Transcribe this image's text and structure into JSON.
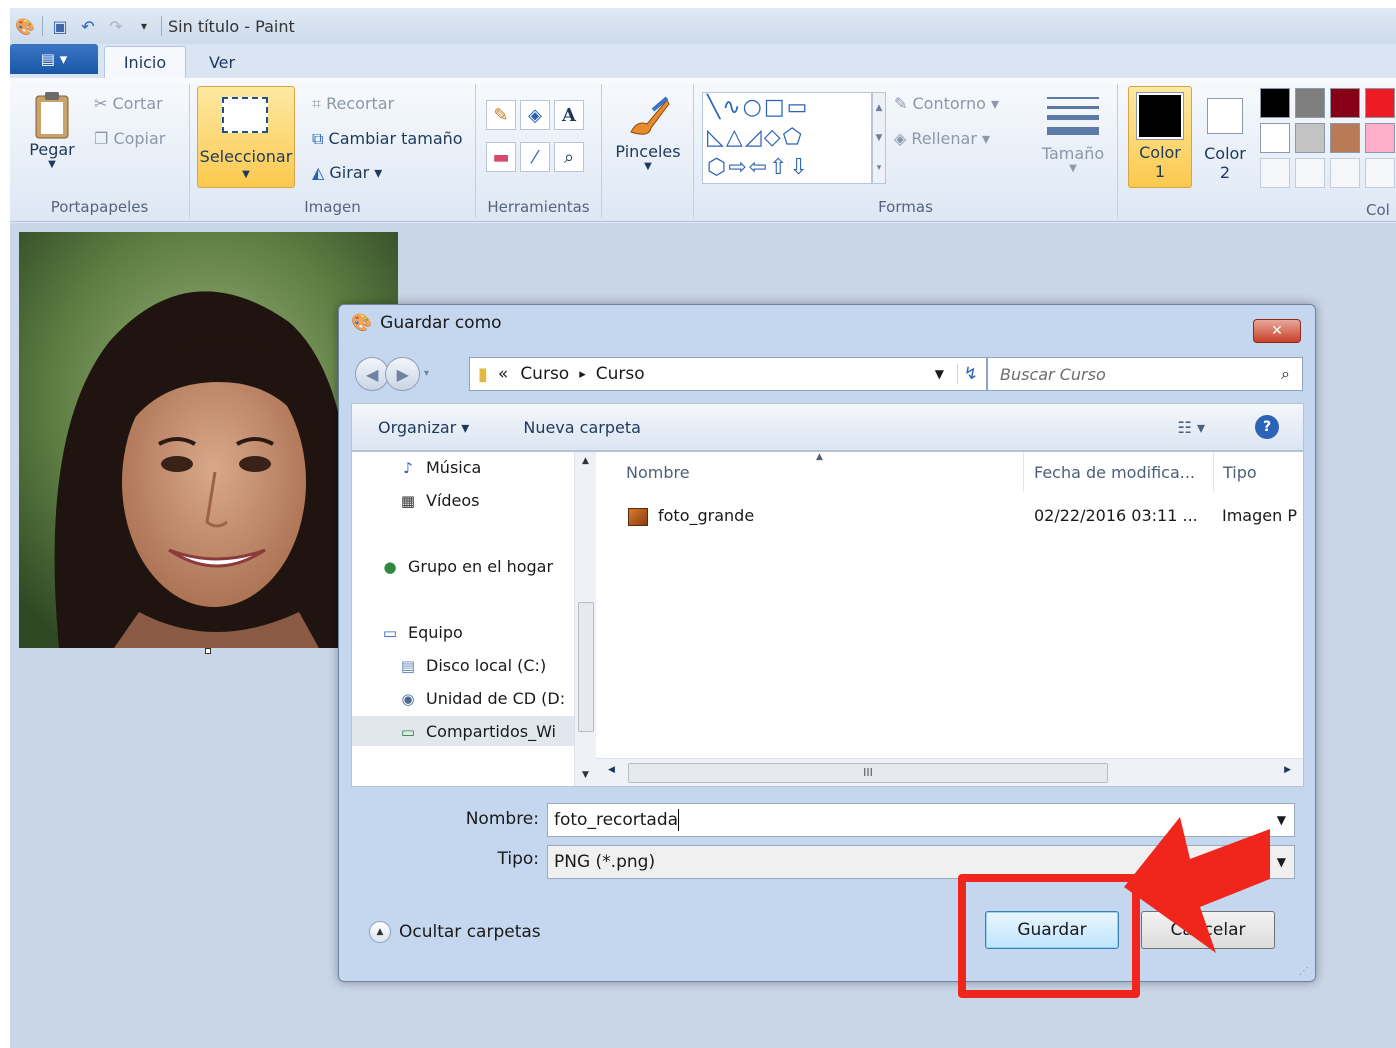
{
  "window": {
    "title": "Sin título - Paint"
  },
  "tabs": {
    "file": "▤ ▾",
    "inicio": "Inicio",
    "ver": "Ver"
  },
  "ribbon": {
    "portapapeles": {
      "label": "Portapapeles",
      "pegar": "Pegar",
      "cortar": "Cortar",
      "copiar": "Copiar"
    },
    "imagen": {
      "label": "Imagen",
      "seleccionar": "Seleccionar",
      "recortar": "Recortar",
      "cambiar": "Cambiar tamaño",
      "girar": "Girar ▾"
    },
    "herramientas": {
      "label": "Herramientas"
    },
    "pinceles": "Pinceles",
    "formas": {
      "label": "Formas",
      "contorno": "Contorno ▾",
      "rellenar": "Rellenar ▾"
    },
    "tamano": "Tamaño",
    "color1": "Color\n1",
    "color2": "Color\n2",
    "colores_label": "Col",
    "palette": [
      "#000000",
      "#7f7f7f",
      "#880015",
      "#ed1c24",
      "#ffffff",
      "#c3c3c3",
      "#b97a57",
      "#ffaec9"
    ]
  },
  "dialog": {
    "title": "Guardar como",
    "close": "✕",
    "breadcrumb": {
      "prefix": "«",
      "part1": "Curso",
      "sep": "▸",
      "part2": "Curso"
    },
    "search_placeholder": "Buscar Curso",
    "cmd": {
      "organizar": "Organizar ▾",
      "nueva": "Nueva carpeta"
    },
    "nav": [
      {
        "label": "Música",
        "icon": "♪"
      },
      {
        "label": "Vídeos",
        "icon": "▦"
      },
      {
        "label": "Grupo en el hogar",
        "icon": "●"
      },
      {
        "label": "Equipo",
        "icon": "▭"
      },
      {
        "label": "Disco local (C:)",
        "icon": "▤"
      },
      {
        "label": "Unidad de CD (D:",
        "icon": "◉"
      },
      {
        "label": "Compartidos_Wi",
        "icon": "▭"
      }
    ],
    "columns": {
      "nombre": "Nombre",
      "fecha": "Fecha de modifica...",
      "tipo": "Tipo"
    },
    "files": [
      {
        "name": "foto_grande",
        "date": "02/22/2016 03:11 ...",
        "type": "Imagen P"
      }
    ],
    "hscroll_grip": "III",
    "form": {
      "nombre_label": "Nombre:",
      "nombre_value": "foto_recortada",
      "tipo_label": "Tipo:",
      "tipo_value": "PNG (*.png)"
    },
    "ocultar": "Ocultar carpetas",
    "guardar": "Guardar",
    "cancelar": "Cancelar"
  }
}
